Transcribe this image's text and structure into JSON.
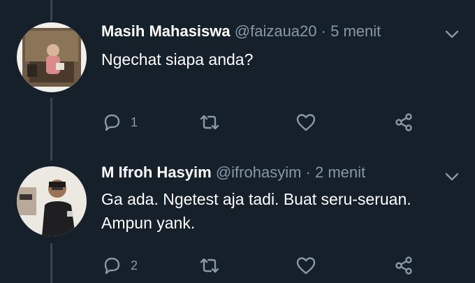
{
  "tweets": [
    {
      "name": "Masih Mahasiswa",
      "handle": "@faizaua20",
      "separator": "·",
      "time": "5 menit",
      "text": "Ngechat siapa anda?",
      "reply_count": "1"
    },
    {
      "name": "M Ifroh Hasyim",
      "handle": "@ifrohasyim",
      "separator": "·",
      "time": "2 menit",
      "text": "Ga ada. Ngetest aja tadi. Buat seru-seruan. Ampun yank.",
      "reply_count": "2"
    }
  ],
  "icons": {
    "reply": "reply-icon",
    "retweet": "retweet-icon",
    "like": "heart-icon",
    "share": "share-icon",
    "menu": "chevron-down-icon"
  },
  "colors": {
    "background": "#15202b",
    "secondary_text": "#8899a6",
    "thread_line": "#38444d"
  }
}
